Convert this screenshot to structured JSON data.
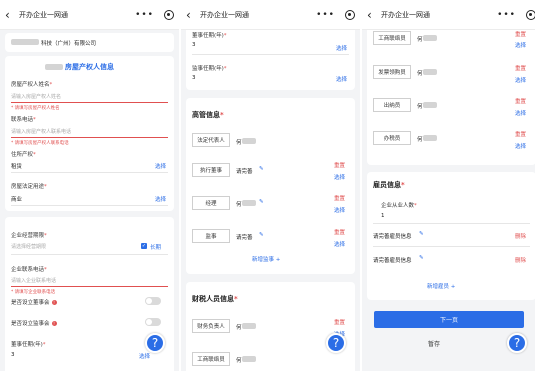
{
  "app": {
    "title": "开办企业一网通",
    "back_icon": "chevron-left-icon",
    "more_icon": "more-icon",
    "close_icon": "close-circle-icon"
  },
  "panel1": {
    "company_suffix": "科技（广州）有限公司",
    "section_title": "房屋产权人信息",
    "owner_name_label": "房屋产权人姓名",
    "owner_name_placeholder": "请输入房屋产权人姓名",
    "owner_name_hint": "* 请填写房屋产权人姓名",
    "contact_phone_label": "联系电话",
    "contact_phone_placeholder": "请输入房屋产权人联系电话",
    "contact_phone_hint": "* 请填写房屋产权人联系电话",
    "property_label": "住所产权",
    "property_value": "租赁",
    "property_action": "选择",
    "usage_label": "房屋法定用途",
    "usage_value": "商业",
    "usage_action": "选择",
    "term_label": "企业经营期限",
    "term_placeholder": "请选择经营期限",
    "term_long": "长期",
    "phone_label": "企业联系电话",
    "phone_placeholder": "请输入企业联系电话",
    "phone_hint": "* 请填写企业联系电话",
    "board_label": "是否设立董事会",
    "supervisor_label": "是否设立监事会",
    "director_term_label": "董事任期(年)",
    "director_term_value": "3",
    "director_term_action": "选择"
  },
  "panel2": {
    "director_term_label": "董事任期(年)",
    "director_term_value": "3",
    "director_term_action": "选择",
    "supervisor_term_label": "监事任期(年)",
    "supervisor_term_value": "3",
    "supervisor_term_action": "选择",
    "exec_section": "高管信息",
    "legal_rep_label": "法定代表人",
    "legal_rep_value": "何",
    "exec_director_label": "执行董事",
    "exec_director_value": "请完善",
    "manager_label": "经理",
    "manager_value": "何",
    "supervisor_label": "监事",
    "supervisor_value": "请完善",
    "reset": "重置",
    "select": "选择",
    "add_director": "新增监事",
    "tax_section": "财税人员信息",
    "finance_label": "财务负责人",
    "finance_value": "何",
    "business_label": "工商联络员",
    "business_value": "何"
  },
  "panel3": {
    "business_label": "工商联络员",
    "business_value": "何",
    "invoice_label": "发票领购员",
    "invoice_value": "何",
    "cashier_label": "出纳员",
    "cashier_value": "何",
    "tax_label": "办税员",
    "tax_value": "何",
    "reset": "重置",
    "select": "选择",
    "emp_section": "雇员信息",
    "emp_count_label": "企业从业人数",
    "emp_count_value": "1",
    "emp1": "请完善雇员信息",
    "emp2": "请完善雇员信息",
    "delete": "删除",
    "add_emp": "新增雇员",
    "next": "下一页",
    "save": "暂存"
  },
  "colors": {
    "accent": "#2b6de6",
    "error": "#e05050",
    "background": "#f3f4f6"
  }
}
